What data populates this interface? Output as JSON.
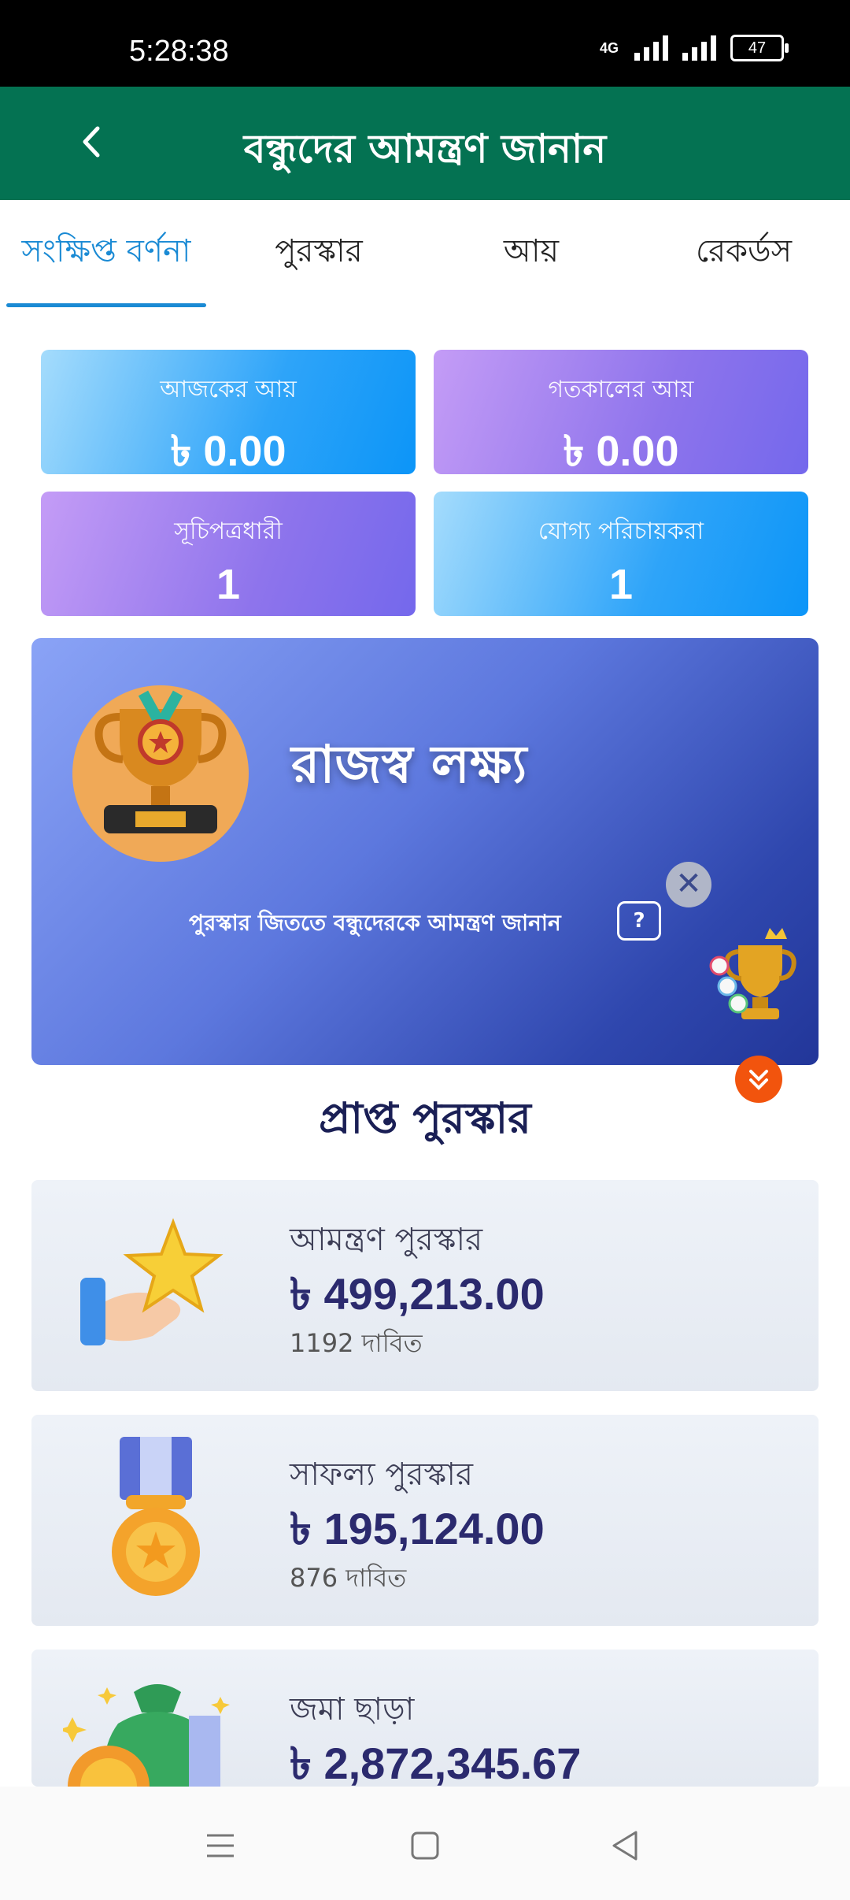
{
  "status_bar": {
    "time": "5:28:38",
    "network": "4G",
    "battery": "47"
  },
  "header": {
    "title": "বন্ধুদের আমন্ত্রণ জানান"
  },
  "tabs": [
    {
      "label": "সংক্ষিপ্ত বর্ণনা",
      "active": true
    },
    {
      "label": "পুরস্কার",
      "active": false
    },
    {
      "label": "আয়",
      "active": false
    },
    {
      "label": "রেকর্ডস",
      "active": false
    }
  ],
  "stats": [
    {
      "label": "আজকের আয়",
      "value": "৳ 0.00"
    },
    {
      "label": "গতকালের আয়",
      "value": "৳ 0.00"
    },
    {
      "label": "সূচিপত্রধারী",
      "value": "1"
    },
    {
      "label": "যোগ্য পরিচায়করা",
      "value": "1"
    }
  ],
  "banner": {
    "title": "রাজস্ব লক্ষ্য",
    "subtitle": "পুরস্কার জিততে বন্ধুদেরকে আমন্ত্রণ জানান",
    "help": "?",
    "close": "✕"
  },
  "rewards_section": {
    "title": "প্রাপ্ত পুরস্কার"
  },
  "rewards": [
    {
      "name": "আমন্ত্রণ পুরস্কার",
      "amount": "৳ 499,213.00",
      "claimed": "1192 দাবিত"
    },
    {
      "name": "সাফল্য পুরস্কার",
      "amount": "৳ 195,124.00",
      "claimed": "876 দাবিত"
    },
    {
      "name": "জমা ছাড়া",
      "amount": "৳ 2,872,345.67",
      "claimed": ""
    }
  ],
  "colors": {
    "header": "#047252",
    "tab_active": "#1a8ad4",
    "amount": "#2b2a6e",
    "float_button": "#f2540d"
  }
}
